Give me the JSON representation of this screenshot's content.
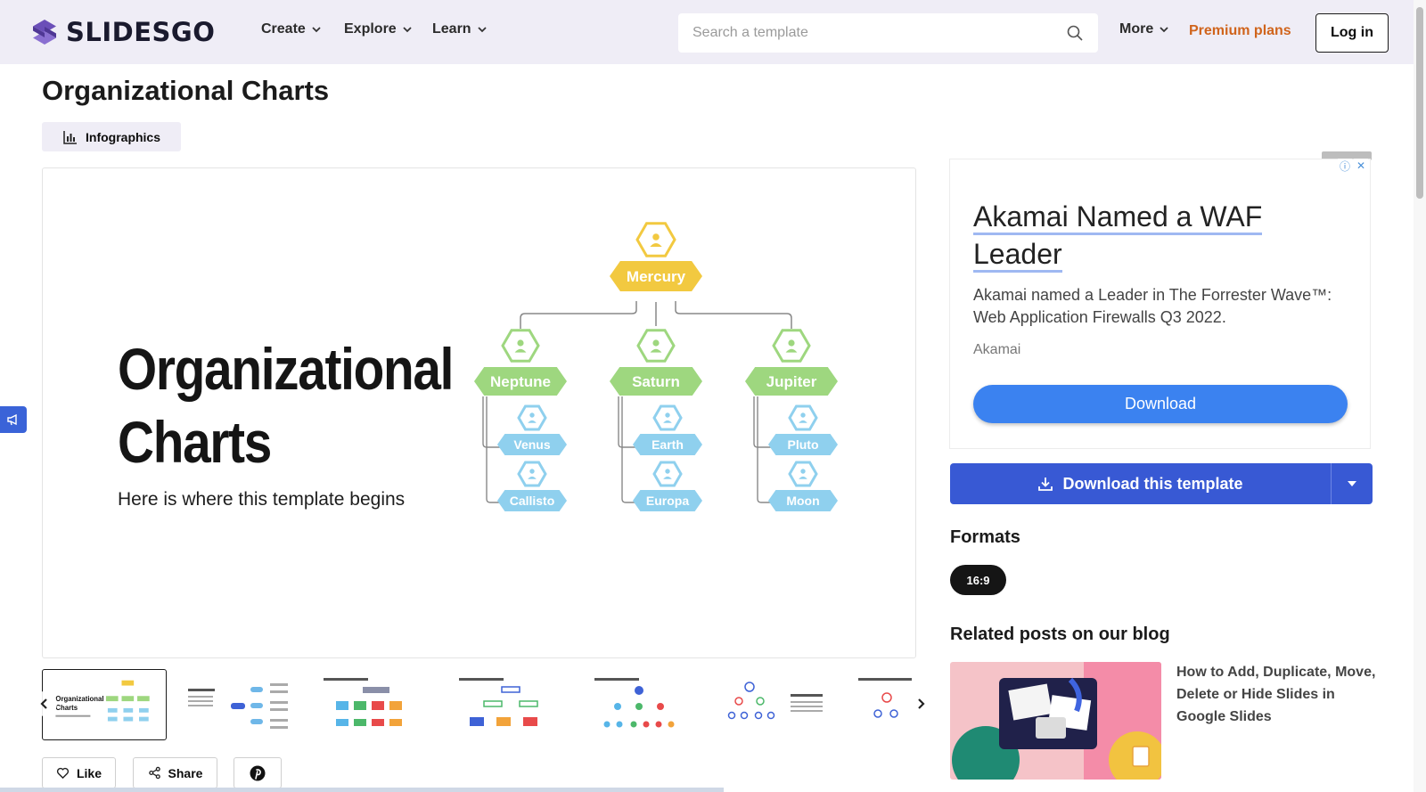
{
  "header": {
    "logo_text": "SLIDESGO",
    "nav": [
      {
        "label": "Create"
      },
      {
        "label": "Explore"
      },
      {
        "label": "Learn"
      }
    ],
    "search_placeholder": "Search a template",
    "more_label": "More",
    "premium_label": "Premium plans",
    "login_label": "Log in"
  },
  "page": {
    "title": "Organizational Charts",
    "tag_label": "Infographics"
  },
  "slide": {
    "title_line1": "Organizational",
    "title_line2": "Charts",
    "subtitle": "Here is where this template begins",
    "chart": {
      "root": "Mercury",
      "branches": [
        {
          "name": "Neptune",
          "children": [
            "Venus",
            "Callisto"
          ],
          "color": "#9ed77f"
        },
        {
          "name": "Saturn",
          "children": [
            "Earth",
            "Europa"
          ],
          "color": "#9ed77f"
        },
        {
          "name": "Jupiter",
          "children": [
            "Pluto",
            "Moon"
          ],
          "color": "#9ed77f"
        }
      ],
      "root_color": "#f2c940",
      "child_color": "#8fd0ee"
    }
  },
  "thumbnail_labels": {
    "t1_line1": "Organizational",
    "t1_line2": "Charts"
  },
  "actions": {
    "like": "Like",
    "share": "Share"
  },
  "ad": {
    "headline_line1": "Akamai Named a WAF",
    "headline_line2": "Leader",
    "body": "Akamai named a Leader in The Forrester Wave™: Web Application Firewalls Q3 2022.",
    "brand": "Akamai",
    "cta": "Download"
  },
  "sidebar": {
    "download_label": "Download this template",
    "formats_heading": "Formats",
    "format_value": "16:9",
    "related_heading": "Related posts on our blog",
    "blog_title": "How to Add, Duplicate, Move, Delete or Hide Slides in Google Slides"
  },
  "colors": {
    "accent": "#3859d4",
    "premium": "#d0641c",
    "header_bg": "#efedf6"
  }
}
